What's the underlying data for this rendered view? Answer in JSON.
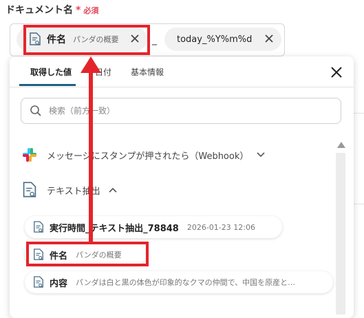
{
  "field": {
    "label": "ドキュメント名",
    "required_mark": "*",
    "required_text": "必須"
  },
  "chips": [
    {
      "label": "件名",
      "value": "パンダの概要"
    },
    {
      "label": "today_%Y%m%d"
    }
  ],
  "separator": "_",
  "tabs": [
    {
      "label": "取得した値"
    },
    {
      "label": "日付"
    },
    {
      "label": "基本情報"
    }
  ],
  "search": {
    "placeholder": "検索（前方一致）"
  },
  "sections": [
    {
      "title": "メッセージにスタンプが押されたら（Webhook）",
      "icon": "slack-icon",
      "state": "collapsed"
    },
    {
      "title": "テキスト抽出",
      "icon": "document-search-icon",
      "state": "expanded"
    }
  ],
  "items": [
    {
      "label": "実行時間_テキスト抽出_78848",
      "value": "2026-01-23 12:06"
    },
    {
      "label": "件名",
      "value": "パンダの概要"
    },
    {
      "label": "内容",
      "value": "パンダは白と黒の体色が印象的なクマの仲間で、中国を原産と…"
    }
  ],
  "colors": {
    "required": "#e0475c",
    "highlight": "#e3252b",
    "tab_active": "#1e5f86",
    "chip_bg": "#f1f1f1",
    "doc_icon": "#4a6f86"
  }
}
